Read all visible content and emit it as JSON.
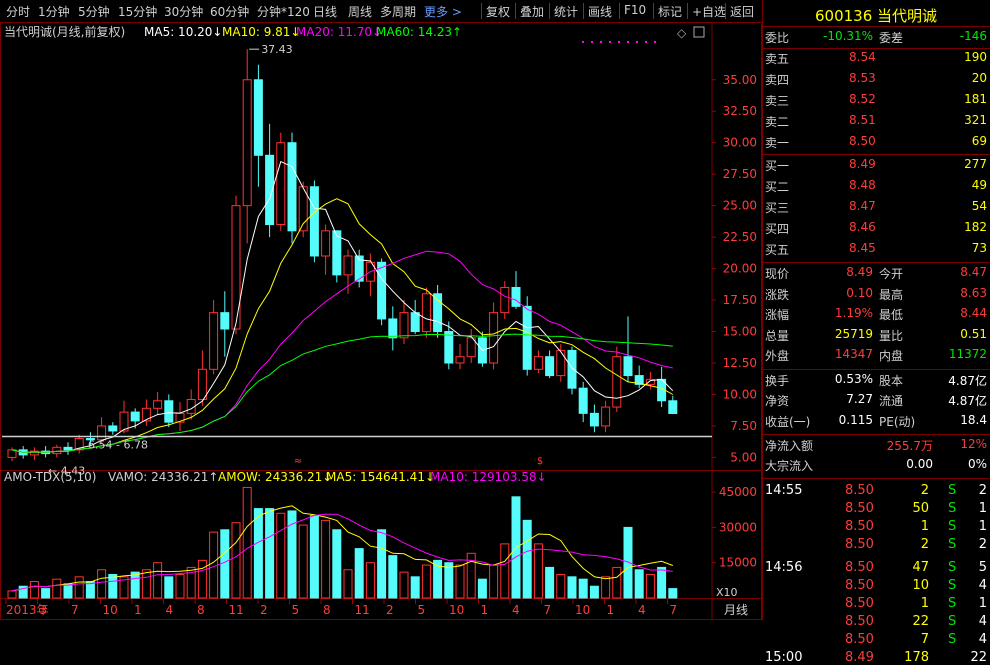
{
  "toolbar": {
    "periods": [
      "分时",
      "1分钟",
      "5分钟",
      "15分钟",
      "30分钟",
      "60分钟",
      "分钟*120",
      "日线",
      "周线",
      "多周期"
    ],
    "more": "更多 >",
    "actions": [
      "复权",
      "叠加",
      "统计",
      "画线",
      "F10",
      "标记",
      "+自选",
      "返回"
    ]
  },
  "legend": {
    "name": "当代明诚(月线,前复权)",
    "ma5": "MA5: 10.20↓",
    "ma10": "MA10: 9.81↓",
    "ma20": "MA20: 11.70↓",
    "ma60": "MA60: 14.23↑",
    "high_mark": "37.43",
    "low_mark": "4.43",
    "mid_mark": "6.54 - 6.78"
  },
  "vol_legend": {
    "name": "AMO-TDX(5,10)",
    "vamo": "VAMO: 24336.21↑",
    "amow": "AMOW: 24336.21↓",
    "ma5": "MA5: 154641.41↓",
    "ma10": "MA10: 129103.58↓",
    "unit": "X10"
  },
  "x_axis": {
    "labels": [
      "2013年",
      "3",
      "7",
      "10",
      "1",
      "4",
      "8",
      "11",
      "2",
      "5",
      "8",
      "11",
      "2",
      "5",
      "10",
      "1",
      "4",
      "7",
      "10",
      "1",
      "4",
      "7"
    ],
    "period_label": "月线"
  },
  "colors": {
    "up": "#ff3232",
    "down": "#54fcfc",
    "ma5": "#ffffff",
    "ma10": "#ffff00",
    "ma20": "#ff00ff",
    "ma60": "#00ff00"
  },
  "chart_data": {
    "type": "candlestick",
    "price_ticks": [
      5.0,
      7.5,
      10.0,
      12.5,
      15.0,
      17.5,
      20.0,
      22.5,
      25.0,
      27.5,
      30.0,
      32.5,
      35.0
    ],
    "ylim": [
      4.0,
      38.0
    ],
    "volume_ticks": [
      15000,
      30000,
      45000
    ],
    "vol_ylim": [
      0,
      51000
    ],
    "candles": [
      [
        5.0,
        5.6,
        4.7,
        5.8
      ],
      [
        5.6,
        5.2,
        4.9,
        5.9
      ],
      [
        5.2,
        5.5,
        4.8,
        5.8
      ],
      [
        5.5,
        5.3,
        5.0,
        5.9
      ],
      [
        5.3,
        5.8,
        5.0,
        6.0
      ],
      [
        5.8,
        5.6,
        5.2,
        6.2
      ],
      [
        5.6,
        6.5,
        5.3,
        6.8
      ],
      [
        6.5,
        6.4,
        6.0,
        7.0
      ],
      [
        6.4,
        7.5,
        6.1,
        8.2
      ],
      [
        7.5,
        7.1,
        6.8,
        7.8
      ],
      [
        7.1,
        8.6,
        6.9,
        9.5
      ],
      [
        8.6,
        7.9,
        7.3,
        8.9
      ],
      [
        7.9,
        8.9,
        7.5,
        9.6
      ],
      [
        8.9,
        9.5,
        8.4,
        10.2
      ],
      [
        9.5,
        7.8,
        7.4,
        10.0
      ],
      [
        7.8,
        8.5,
        7.1,
        9.4
      ],
      [
        8.5,
        9.6,
        8.0,
        10.4
      ],
      [
        9.6,
        12.0,
        9.1,
        13.5
      ],
      [
        12.0,
        16.5,
        11.6,
        17.5
      ],
      [
        16.5,
        15.2,
        13.0,
        18.2
      ],
      [
        15.2,
        25.0,
        14.8,
        25.8
      ],
      [
        25.0,
        35.0,
        22.0,
        37.43
      ],
      [
        35.0,
        29.0,
        26.5,
        36.2
      ],
      [
        29.0,
        23.5,
        22.5,
        31.5
      ],
      [
        23.5,
        30.0,
        23.0,
        30.8
      ],
      [
        30.0,
        23.0,
        22.0,
        30.8
      ],
      [
        23.0,
        26.5,
        22.5,
        26.9
      ],
      [
        26.5,
        21.0,
        20.5,
        27.0
      ],
      [
        21.0,
        23.0,
        19.5,
        23.5
      ],
      [
        23.0,
        19.5,
        18.9,
        23.0
      ],
      [
        19.5,
        21.0,
        18.0,
        21.5
      ],
      [
        21.0,
        19.0,
        18.5,
        21.5
      ],
      [
        19.0,
        20.5,
        17.8,
        21.2
      ],
      [
        20.5,
        16.0,
        15.5,
        20.8
      ],
      [
        16.0,
        14.5,
        13.5,
        17.0
      ],
      [
        14.5,
        16.5,
        14.0,
        17.5
      ],
      [
        16.5,
        15.0,
        14.8,
        17.5
      ],
      [
        15.0,
        18.0,
        14.5,
        18.5
      ],
      [
        18.0,
        15.0,
        14.5,
        18.7
      ],
      [
        15.0,
        12.5,
        12.0,
        15.8
      ],
      [
        12.5,
        13.0,
        12.0,
        14.0
      ],
      [
        13.0,
        14.5,
        12.5,
        15.2
      ],
      [
        14.5,
        12.5,
        12.2,
        15.0
      ],
      [
        12.5,
        16.5,
        12.0,
        17.3
      ],
      [
        16.5,
        18.5,
        16.0,
        19.0
      ],
      [
        18.5,
        17.0,
        16.8,
        19.8
      ],
      [
        17.0,
        12.0,
        11.5,
        17.8
      ],
      [
        12.0,
        13.0,
        11.7,
        13.5
      ],
      [
        13.0,
        11.5,
        11.3,
        13.5
      ],
      [
        11.5,
        13.5,
        11.0,
        14.0
      ],
      [
        13.5,
        10.5,
        10.0,
        13.8
      ],
      [
        10.5,
        8.5,
        7.8,
        11.0
      ],
      [
        8.5,
        7.5,
        7.0,
        9.2
      ],
      [
        7.5,
        9.0,
        7.0,
        9.5
      ],
      [
        9.0,
        13.0,
        8.6,
        13.8
      ],
      [
        13.0,
        11.5,
        11.0,
        16.2
      ],
      [
        11.5,
        10.8,
        10.5,
        12.3
      ],
      [
        10.8,
        11.2,
        10.4,
        11.8
      ],
      [
        11.2,
        9.5,
        9.0,
        12.2
      ],
      [
        9.5,
        8.49,
        8.44,
        9.9
      ]
    ],
    "volumes": [
      300,
      500,
      700,
      400,
      800,
      600,
      900,
      700,
      1200,
      1000,
      900,
      1100,
      1200,
      1500,
      900,
      1000,
      1300,
      1600,
      2800,
      2900,
      3200,
      4700,
      3800,
      3800,
      3600,
      3700,
      3100,
      3500,
      3300,
      2900,
      1200,
      2100,
      1500,
      2900,
      1800,
      1100,
      900,
      1400,
      1600,
      1500,
      1400,
      1900,
      800,
      1400,
      2300,
      4300,
      3300,
      2300,
      1300,
      1000,
      900,
      800,
      500,
      900,
      1300,
      3000,
      1200,
      1000,
      1300,
      400
    ]
  },
  "stock": {
    "code_name": "600136 当代明诚",
    "weibi_label": "委比",
    "weibi": "-10.31%",
    "weicha_label": "委差",
    "weicha": "-146",
    "sell": [
      {
        "label": "卖五",
        "price": "8.54",
        "vol": "190"
      },
      {
        "label": "卖四",
        "price": "8.53",
        "vol": "20"
      },
      {
        "label": "卖三",
        "price": "8.52",
        "vol": "181"
      },
      {
        "label": "卖二",
        "price": "8.51",
        "vol": "321"
      },
      {
        "label": "卖一",
        "price": "8.50",
        "vol": "69"
      }
    ],
    "buy": [
      {
        "label": "买一",
        "price": "8.49",
        "vol": "277"
      },
      {
        "label": "买二",
        "price": "8.48",
        "vol": "49"
      },
      {
        "label": "买三",
        "price": "8.47",
        "vol": "54"
      },
      {
        "label": "买四",
        "price": "8.46",
        "vol": "182"
      },
      {
        "label": "买五",
        "price": "8.45",
        "vol": "73"
      }
    ],
    "quote": [
      {
        "l1": "现价",
        "v1": "8.49",
        "c1": "red",
        "l2": "今开",
        "v2": "8.47",
        "c2": "red"
      },
      {
        "l1": "涨跌",
        "v1": "0.10",
        "c1": "red",
        "l2": "最高",
        "v2": "8.63",
        "c2": "red"
      },
      {
        "l1": "涨幅",
        "v1": "1.19%",
        "c1": "red",
        "l2": "最低",
        "v2": "8.44",
        "c2": "red"
      },
      {
        "l1": "总量",
        "v1": "25719",
        "c1": "yellow",
        "l2": "量比",
        "v2": "0.51",
        "c2": "yellow"
      },
      {
        "l1": "外盘",
        "v1": "14347",
        "c1": "red",
        "l2": "内盘",
        "v2": "11372",
        "c2": "green"
      }
    ],
    "stats": [
      {
        "l1": "换手",
        "v1": "0.53%",
        "l2": "股本",
        "v2": "4.87亿"
      },
      {
        "l1": "净资",
        "v1": "7.27",
        "l2": "流通",
        "v2": "4.87亿"
      },
      {
        "l1": "收益(一)",
        "v1": "0.115",
        "l2": "PE(动)",
        "v2": "18.4"
      }
    ],
    "flow": [
      {
        "label": "净流入额",
        "value": "255.7万",
        "pct": "12%"
      },
      {
        "label": "大宗流入",
        "value": "0.00",
        "pct": "0%"
      }
    ],
    "ticks": [
      {
        "time": "14:55",
        "price": "8.50",
        "vol": "2",
        "bs": "S",
        "n": "2"
      },
      {
        "time": "",
        "price": "8.50",
        "vol": "50",
        "bs": "S",
        "n": "1"
      },
      {
        "time": "",
        "price": "8.50",
        "vol": "1",
        "bs": "S",
        "n": "1"
      },
      {
        "time": "",
        "price": "8.50",
        "vol": "2",
        "bs": "S",
        "n": "2"
      },
      {
        "time": "14:56",
        "price": "8.50",
        "vol": "47",
        "bs": "S",
        "n": "5"
      },
      {
        "time": "",
        "price": "8.50",
        "vol": "10",
        "bs": "S",
        "n": "4"
      },
      {
        "time": "",
        "price": "8.50",
        "vol": "1",
        "bs": "S",
        "n": "1"
      },
      {
        "time": "",
        "price": "8.50",
        "vol": "22",
        "bs": "S",
        "n": "4"
      },
      {
        "time": "",
        "price": "8.50",
        "vol": "7",
        "bs": "S",
        "n": "4"
      },
      {
        "time": "15:00",
        "price": "8.49",
        "vol": "178",
        "bs": "",
        "n": "22"
      }
    ]
  }
}
